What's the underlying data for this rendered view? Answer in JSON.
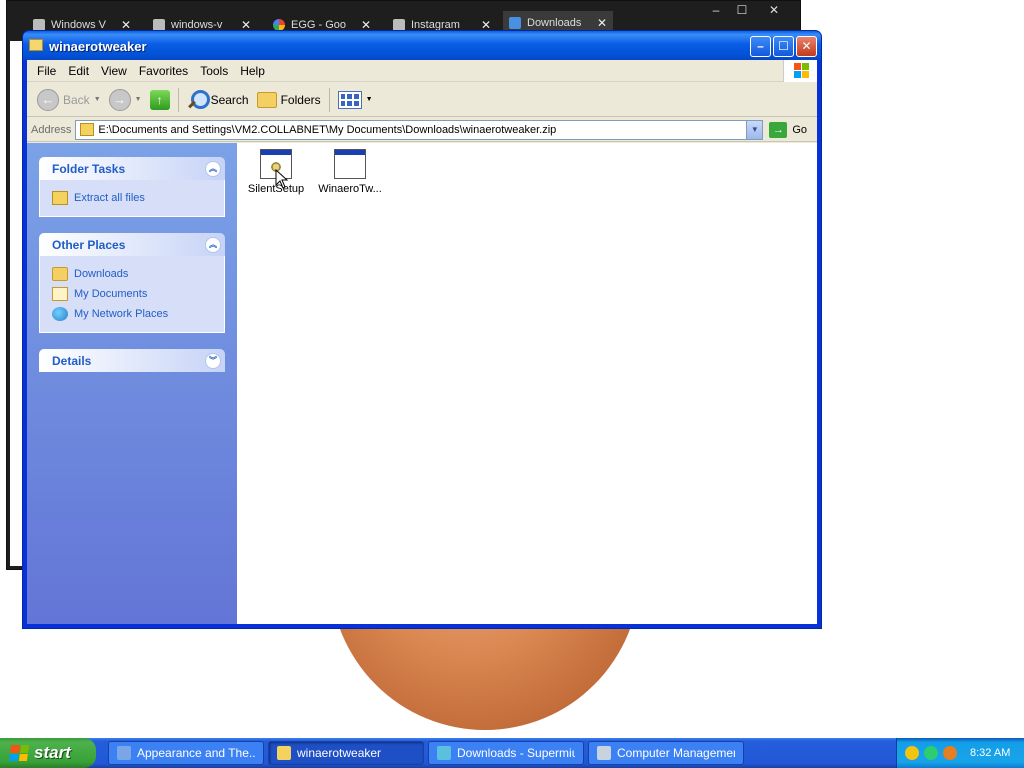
{
  "browser": {
    "tabs": [
      {
        "title": "Windows V",
        "icon": "document-icon"
      },
      {
        "title": "windows-v",
        "icon": "document-icon"
      },
      {
        "title": "EGG - Goo",
        "icon": "google-icon"
      },
      {
        "title": "Instagram",
        "icon": "instagram-icon"
      },
      {
        "title": "Downloads",
        "icon": "download-icon"
      }
    ],
    "close_glyph": "✕",
    "controls": {
      "minimize": "–",
      "maximize": "☐",
      "close": "✕"
    }
  },
  "explorer": {
    "title": "winaerotweaker",
    "menu": [
      "File",
      "Edit",
      "View",
      "Favorites",
      "Tools",
      "Help"
    ],
    "toolbar": {
      "back": "Back",
      "search": "Search",
      "folders": "Folders"
    },
    "address": {
      "label": "Address",
      "value": "E:\\Documents and Settings\\VM2.COLLABNET\\My Documents\\Downloads\\winaerotweaker.zip",
      "go": "Go"
    },
    "task_pane": {
      "folder_tasks": {
        "title": "Folder Tasks",
        "links": [
          "Extract all files"
        ]
      },
      "other_places": {
        "title": "Other Places",
        "links": [
          "Downloads",
          "My Documents",
          "My Network Places"
        ]
      },
      "details": {
        "title": "Details"
      }
    },
    "files": [
      {
        "name": "SilentSetup"
      },
      {
        "name": "WinaeroTw..."
      }
    ]
  },
  "taskbar": {
    "start": "start",
    "tasks": [
      {
        "label": "Appearance and The...",
        "active": false
      },
      {
        "label": "winaerotweaker",
        "active": true
      },
      {
        "label": "Downloads - Supermium",
        "active": false
      },
      {
        "label": "Computer Management",
        "active": false
      }
    ],
    "clock": "8:32 AM"
  }
}
